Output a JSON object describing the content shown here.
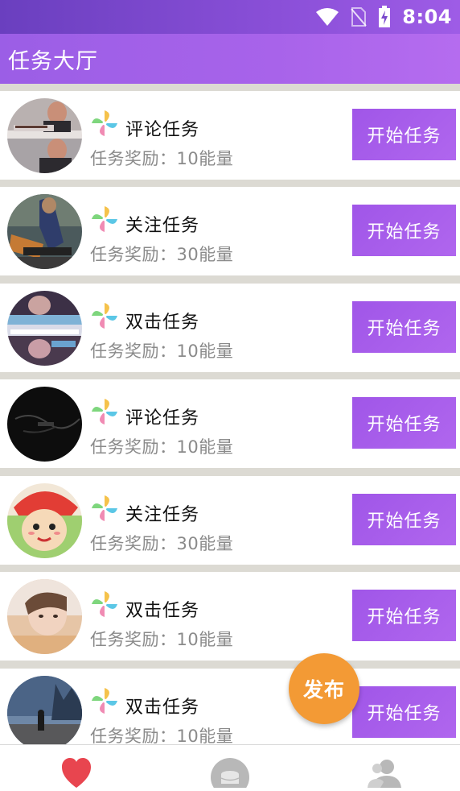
{
  "status_bar": {
    "time": "8:04",
    "icons": [
      "wifi-icon",
      "no-sim-icon",
      "battery-charging-icon"
    ]
  },
  "app_bar": {
    "title": "任务大厅"
  },
  "tasks": [
    {
      "avatar": "avatar-man-caption",
      "name": "评论任务",
      "reward": "任务奖励：10能量",
      "button": "开始任务"
    },
    {
      "avatar": "avatar-worker",
      "name": "关注任务",
      "reward": "任务奖励：30能量",
      "button": "开始任务"
    },
    {
      "avatar": "avatar-screenshot",
      "name": "双击任务",
      "reward": "任务奖励：10能量",
      "button": "开始任务"
    },
    {
      "avatar": "avatar-dark",
      "name": "评论任务",
      "reward": "任务奖励：10能量",
      "button": "开始任务"
    },
    {
      "avatar": "avatar-cartoon",
      "name": "关注任务",
      "reward": "任务奖励：30能量",
      "button": "开始任务"
    },
    {
      "avatar": "avatar-girl",
      "name": "双击任务",
      "reward": "任务奖励：10能量",
      "button": "开始任务"
    },
    {
      "avatar": "avatar-night-figure",
      "name": "双击任务",
      "reward": "任务奖励：10能量",
      "button": "开始任务"
    }
  ],
  "fab": {
    "label": "发布"
  },
  "bottom_nav": [
    {
      "icon": "heart-icon",
      "active": true,
      "color": "#e8454f"
    },
    {
      "icon": "coins-icon",
      "active": false,
      "color": "#b8b8b8"
    },
    {
      "icon": "user-icon",
      "active": false,
      "color": "#b8b8b8"
    }
  ],
  "colors": {
    "accent": "#a863ea",
    "button": "#a95fec",
    "fab": "#f39a35",
    "reward_text": "#8a8a8a",
    "divider": "#dcdad3"
  }
}
